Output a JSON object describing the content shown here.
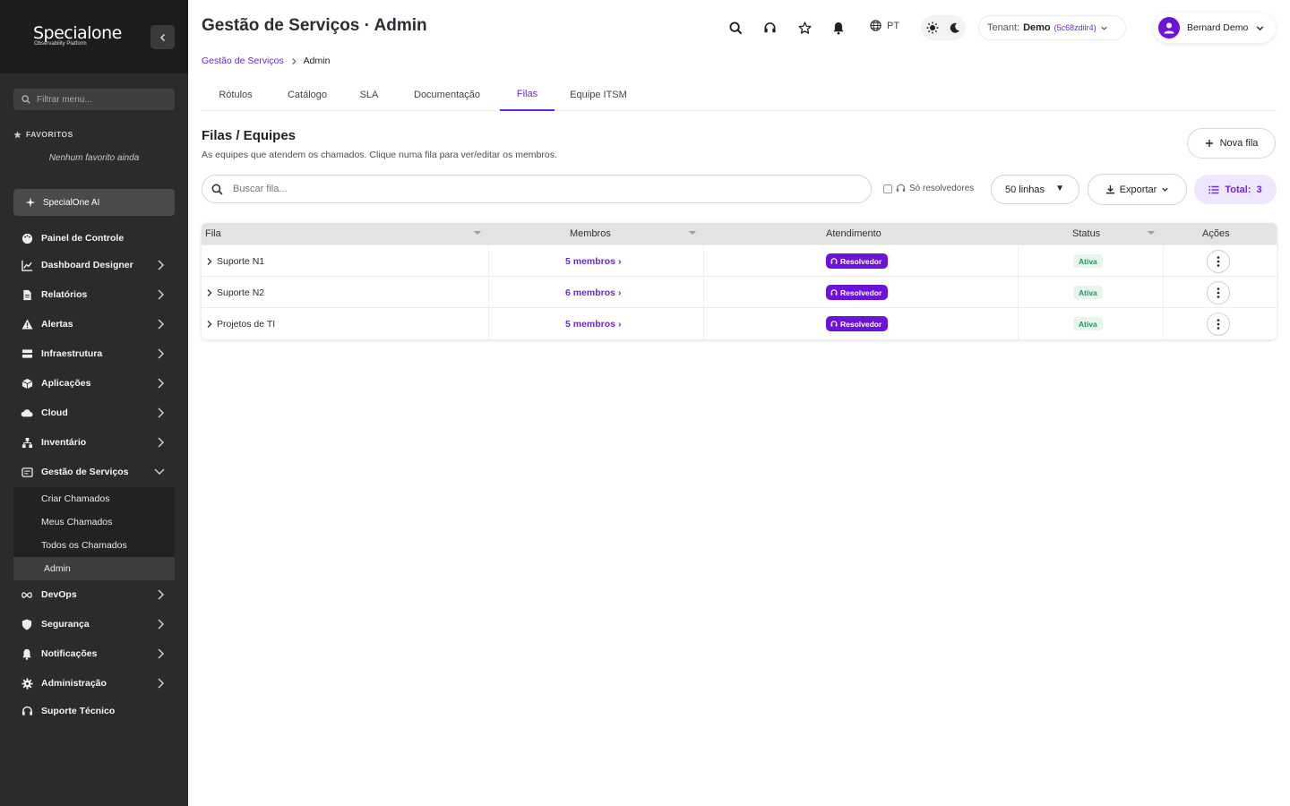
{
  "sidebar": {
    "logo": {
      "name": "Specialone",
      "tagline": "Observability Platform"
    },
    "filter_placeholder": "Filtrar menu...",
    "favorites": {
      "title": "FAVORITOS",
      "empty": "Nenhum favorito ainda"
    },
    "ai_label": "SpecialOne AI",
    "items": [
      {
        "label": "Painel de Controle",
        "icon": "palette-icon"
      },
      {
        "label": "Dashboard Designer",
        "icon": "chart-line-icon"
      },
      {
        "label": "Relatórios",
        "icon": "file-icon"
      },
      {
        "label": "Alertas",
        "icon": "warning-icon"
      },
      {
        "label": "Infraestrutura",
        "icon": "server-icon"
      },
      {
        "label": "Aplicações",
        "icon": "cube-icon"
      },
      {
        "label": "Cloud",
        "icon": "cloud-icon"
      },
      {
        "label": "Inventário",
        "icon": "sitemap-icon"
      },
      {
        "label": "Gestão de Serviços",
        "icon": "service-icon"
      },
      {
        "label": "DevOps",
        "icon": "infinity-icon"
      },
      {
        "label": "Segurança",
        "icon": "shield-icon"
      },
      {
        "label": "Notificações",
        "icon": "bell-icon"
      },
      {
        "label": "Administração",
        "icon": "gear-icon"
      },
      {
        "label": "Suporte Técnico",
        "icon": "headset-icon"
      }
    ],
    "submenu": [
      "Criar Chamados",
      "Meus Chamados",
      "Todos os Chamados",
      "Admin"
    ]
  },
  "header": {
    "title": "Gestão de Serviços · Admin",
    "lang": "PT",
    "tenant_label": "Tenant:",
    "tenant_name": "Demo",
    "tenant_code": "(5c68zdilr4)",
    "user_name": "Bernard Demo"
  },
  "breadcrumb": {
    "parent": "Gestão de Serviços",
    "current": "Admin"
  },
  "tabs": [
    "Rótulos",
    "Catálogo",
    "SLA",
    "Documentação",
    "Filas",
    "Equipe ITSM"
  ],
  "active_tab": "Filas",
  "section": {
    "title": "Filas / Equipes",
    "description": "As equipes que atendem os chamados. Clique numa fila para ver/editar os membros.",
    "new_button": "Nova fila"
  },
  "toolbar": {
    "search_placeholder": "Buscar fila...",
    "resolvers_label": "Só resolvedores",
    "rows_label": "50 linhas",
    "export_label": "Exportar",
    "total_label": "Total:",
    "total_value": "3"
  },
  "table": {
    "columns": [
      "Fila",
      "Membros",
      "Atendimento",
      "Status",
      "Ações"
    ],
    "rows": [
      {
        "fila": "Suporte N1",
        "membros": "5 membros ›",
        "atendimento": "Resolvedor",
        "status": "Ativa"
      },
      {
        "fila": "Suporte N2",
        "membros": "6 membros ›",
        "atendimento": "Resolvedor",
        "status": "Ativa"
      },
      {
        "fila": "Projetos de TI",
        "membros": "5 membros ›",
        "atendimento": "Resolvedor",
        "status": "Ativa"
      }
    ]
  },
  "colors": {
    "accent": "#6d28d9",
    "pill": "#6d12d9",
    "sidebar": "#2b2b2b",
    "success": "#1d9a5a"
  }
}
